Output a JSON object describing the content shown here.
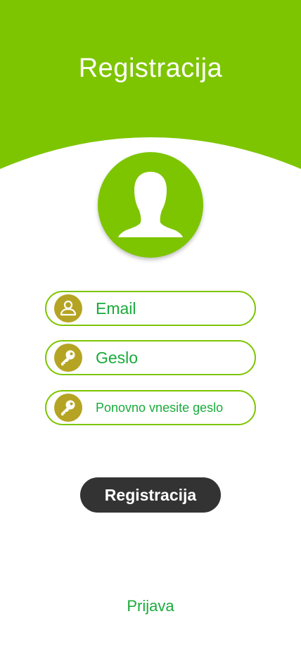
{
  "header": {
    "title": "Registracija"
  },
  "avatar": {
    "icon": "user-silhouette-icon"
  },
  "form": {
    "email": {
      "placeholder": "Email",
      "value": "",
      "icon": "user-icon"
    },
    "password": {
      "placeholder": "Geslo",
      "value": "",
      "icon": "key-icon"
    },
    "password_repeat": {
      "placeholder": "Ponovno vnesite geslo",
      "value": "",
      "icon": "key-icon"
    }
  },
  "actions": {
    "register_label": "Registracija",
    "login_label": "Prijava"
  },
  "colors": {
    "brand_green": "#7dc500",
    "text_green": "#1aab3c",
    "icon_gold": "#b5a423",
    "button_dark": "#333333"
  }
}
